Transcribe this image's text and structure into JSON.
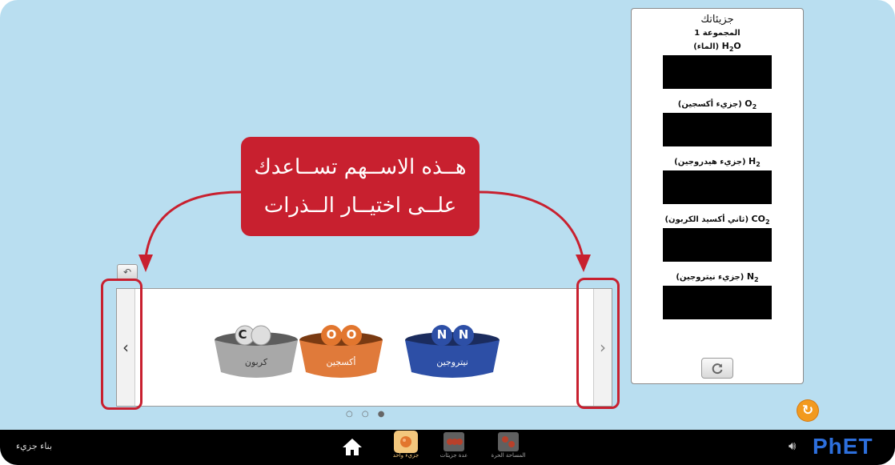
{
  "panel": {
    "title": "جزيئاتك",
    "group": "المجموعة 1",
    "molecules": [
      {
        "formula": "H",
        "sub": "2",
        "formula_tail": "O",
        "name": "(الماء)"
      },
      {
        "formula": "O",
        "sub": "2",
        "formula_tail": "",
        "name": "(جزيء أكسجين)"
      },
      {
        "formula": "H",
        "sub": "2",
        "formula_tail": "",
        "name": "(جزيء هيدروجين)"
      },
      {
        "formula": "CO",
        "sub": "2",
        "formula_tail": "",
        "name": "(ثاني أكسيد الكربون)"
      },
      {
        "formula": "N",
        "sub": "2",
        "formula_tail": "",
        "name": "(جزيء نيتروجين)"
      }
    ]
  },
  "callout": {
    "line1": "هــذه الاســهم تســاعدك",
    "line2": "علــى اختيــار الــذرات"
  },
  "buckets": [
    {
      "label": "كربون",
      "atom": "C",
      "color": "#a8a8a8"
    },
    {
      "label": "أكسجين",
      "atom": "O",
      "color": "#e2762e"
    },
    {
      "label": "نيتروجين",
      "atom": "N",
      "color": "#2d4fa6"
    }
  ],
  "carousel": {
    "prev": "‹",
    "next": "›",
    "dots": "○ ○ ●"
  },
  "navbar": {
    "screen_title": "بناء جزيء",
    "screens": [
      {
        "label": "جزيء واحد",
        "active": true
      },
      {
        "label": "عدة جزيئات",
        "active": false
      },
      {
        "label": "المساحة الحرة",
        "active": false
      }
    ],
    "logo": "PhET"
  },
  "colors": {
    "background": "#b9def0",
    "highlight": "#c8202f",
    "navbar": "#000000",
    "accent": "#f29a1f"
  }
}
